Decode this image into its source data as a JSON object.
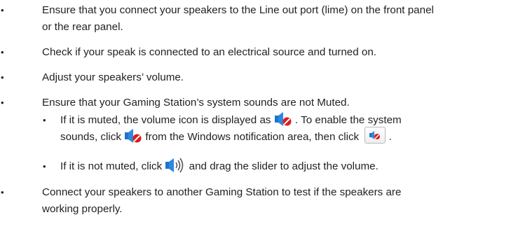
{
  "bullets": {
    "main": "•",
    "sub": "•"
  },
  "items": [
    {
      "lines": [
        "Ensure that you connect your speakers to the Line out port (lime) on the front panel",
        "or the rear panel."
      ]
    },
    {
      "lines": [
        "Check if your speak is connected to an electrical source and turned on."
      ]
    },
    {
      "lines": [
        "Adjust your speakers’ volume."
      ]
    },
    {
      "lines": [
        "Ensure that your Gaming Station’s system sounds are not Muted."
      ]
    }
  ],
  "sub_items": [
    {
      "line1_before_icon": "If it is muted, the volume icon is displayed as",
      "line1_after_icon": ". To enable the system",
      "line2_before_icon": "sounds, click",
      "line2_middle": "from the Windows notification area, then click",
      "line2_end": "."
    },
    {
      "before_icon": "If it is not muted, click",
      "after_icon": "and drag the slider to adjust the volume."
    }
  ],
  "last_item": {
    "lines": [
      "Connect your speakers to another Gaming Station to test if the speakers are",
      "working properly."
    ]
  },
  "icons": {
    "muted_speaker": "speaker-muted-icon",
    "unmuted_speaker": "speaker-unmuted-icon",
    "mute_button": "mute-toggle-button-icon"
  }
}
